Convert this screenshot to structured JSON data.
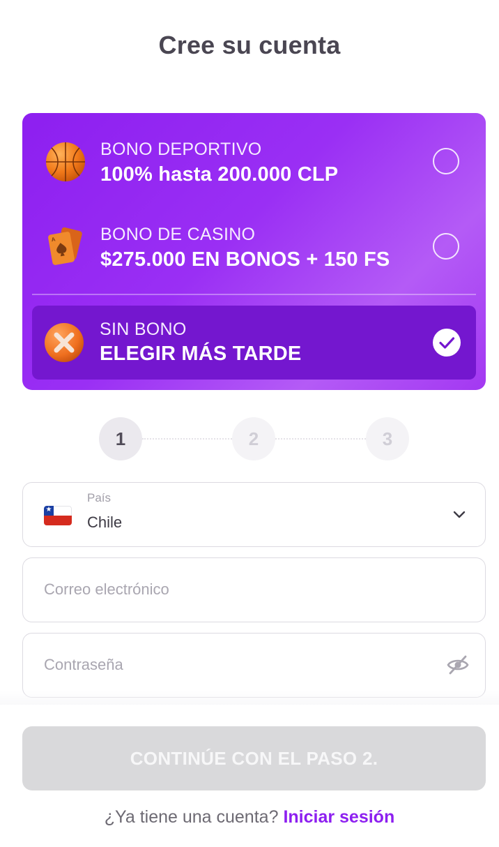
{
  "page": {
    "title": "Cree su cuenta"
  },
  "bonuses": [
    {
      "kind": "BONO DEPORTIVO",
      "value": "100% hasta 200.000 CLP",
      "icon": "basketball-icon",
      "selected": false
    },
    {
      "kind": "BONO DE CASINO",
      "value": "$275.000 EN BONOS + 150 FS",
      "icon": "playing-card-icon",
      "selected": false
    },
    {
      "kind": "SIN BONO",
      "value": "ELEGIR MÁS TARDE",
      "icon": "no-bonus-x-icon",
      "selected": true
    }
  ],
  "steps": [
    "1",
    "2",
    "3"
  ],
  "current_step": 1,
  "form": {
    "country": {
      "label": "País",
      "value": "Chile",
      "flag": "chile-flag-icon"
    },
    "email": {
      "placeholder": "Correo electrónico",
      "value": ""
    },
    "password": {
      "placeholder": "Contraseña",
      "value": "",
      "toggle_icon": "eye-hidden-icon"
    }
  },
  "actions": {
    "continue_label": "CONTINÚE CON EL PASO 2.",
    "has_account_text": "¿Ya tiene una cuenta?",
    "login_label": "Iniciar sesión"
  },
  "colors": {
    "accent": "#8d1ff0",
    "panel_gradient_start": "#8d1ff0",
    "panel_gradient_end": "#b45bf6",
    "selected_row": "#7417cf",
    "disabled_button": "#d9d9db"
  }
}
